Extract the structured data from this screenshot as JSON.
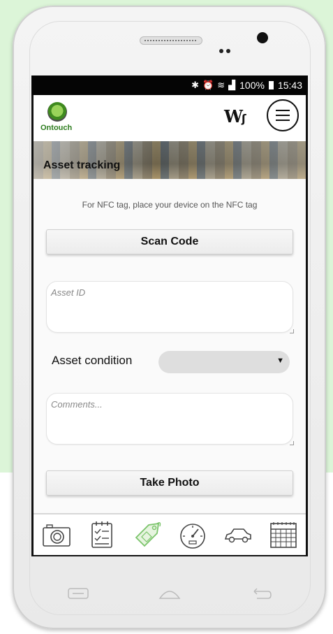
{
  "status_bar": {
    "icons": [
      "bluetooth-icon",
      "alarm-icon",
      "wifi-icon",
      "signal-icon"
    ],
    "battery": "100%",
    "time": "15:43"
  },
  "header": {
    "logo_text": "Ontouch",
    "brand_mark": "W"
  },
  "banner": {
    "title": "Asset tracking"
  },
  "nfc_hint": "For NFC tag, place your device on the NFC tag",
  "scan_button": "Scan Code",
  "asset_id": {
    "placeholder": "Asset ID",
    "value": ""
  },
  "asset_condition": {
    "label": "Asset condition",
    "selected": ""
  },
  "comments": {
    "placeholder": "Comments...",
    "value": ""
  },
  "photo_button": "Take Photo",
  "tabs": [
    {
      "icon": "camera-icon"
    },
    {
      "icon": "checklist-icon"
    },
    {
      "icon": "tag-icon",
      "active": true
    },
    {
      "icon": "speedometer-icon"
    },
    {
      "icon": "car-icon"
    },
    {
      "icon": "calendar-icon"
    }
  ],
  "colors": {
    "background": "#dcf5d8",
    "active_tab": "#7bc46b",
    "brand_green": "#2e7d1f"
  }
}
